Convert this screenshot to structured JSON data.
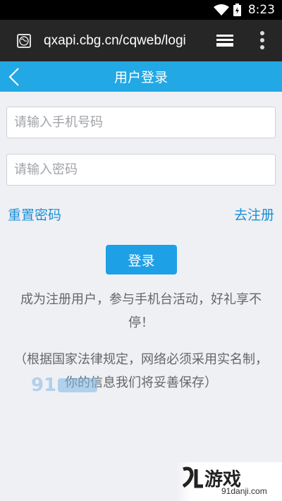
{
  "status_bar": {
    "time": "8:23",
    "icons": [
      "wifi-icon",
      "battery-icon"
    ]
  },
  "browser": {
    "url": "qxapi.cbg.cn/cqweb/logi",
    "icons": [
      "globe-icon",
      "tabs-icon",
      "more-vert-icon"
    ]
  },
  "header": {
    "title": "用户登录",
    "back_icon": "chevron-left-icon"
  },
  "form": {
    "phone_placeholder": "请输入手机号码",
    "phone_value": "",
    "password_placeholder": "请输入密码",
    "password_value": "",
    "reset_password_label": "重置密码",
    "register_label": "去注册",
    "login_label": "登录"
  },
  "messages": {
    "promo": "成为注册用户，参与手机台活动，好礼享不停！",
    "notice": "（根据国家法律规定，网络必须采用实名制，你的信息我们将妥善保存）"
  },
  "watermark": {
    "brand": "游戏",
    "site": "91danji.com"
  },
  "colors": {
    "accent": "#22a8e4",
    "button": "#1ea0e6",
    "link": "#1b8fd6",
    "background": "#eff0f4"
  }
}
